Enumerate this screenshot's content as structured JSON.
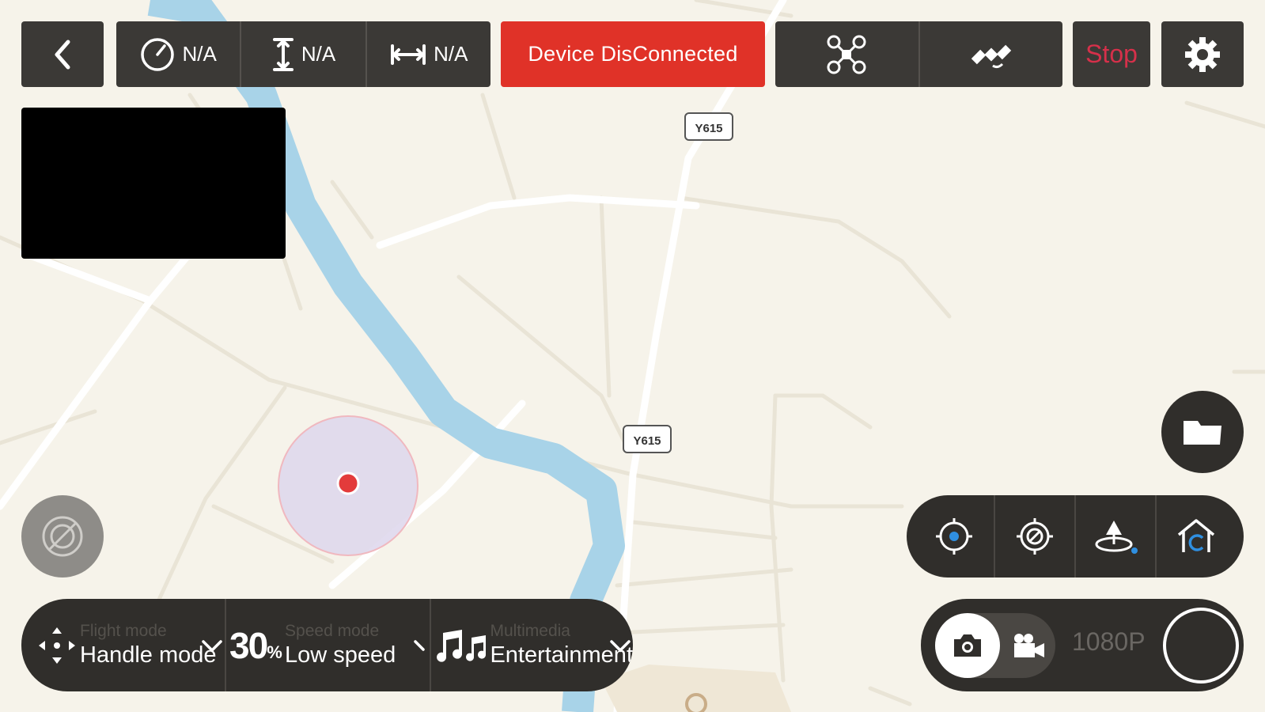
{
  "telemetry": {
    "speed": "N/A",
    "altitude": "N/A",
    "distance": "N/A"
  },
  "device_status": "Device DisConnected",
  "stop_label": "Stop",
  "map": {
    "road_shields": [
      "Y615",
      "Y615"
    ]
  },
  "bottom_bar": {
    "flight_mode": {
      "caption": "Flight mode",
      "value": "Handle mode"
    },
    "speed_mode": {
      "caption": "Speed mode",
      "percent": "30",
      "percent_sign": "%",
      "value": "Low speed"
    },
    "multimedia": {
      "caption": "Multimedia",
      "value": "Entertainment"
    }
  },
  "capture": {
    "resolution": "1080P"
  },
  "icons": [
    "back-icon",
    "speedometer-icon",
    "altitude-icon",
    "distance-icon",
    "drone-icon",
    "satellite-icon",
    "gear-icon",
    "compass-icon",
    "folder-icon",
    "locate-icon",
    "target-icon",
    "takeoff-icon",
    "home-icon",
    "move-icon",
    "music-icon",
    "camera-icon",
    "video-camera-icon"
  ],
  "colors": {
    "alert": "#e03228",
    "stop": "#d6304a",
    "panel": "#302e2b",
    "river": "#a8d3e8",
    "accent": "#2f8fe0"
  }
}
